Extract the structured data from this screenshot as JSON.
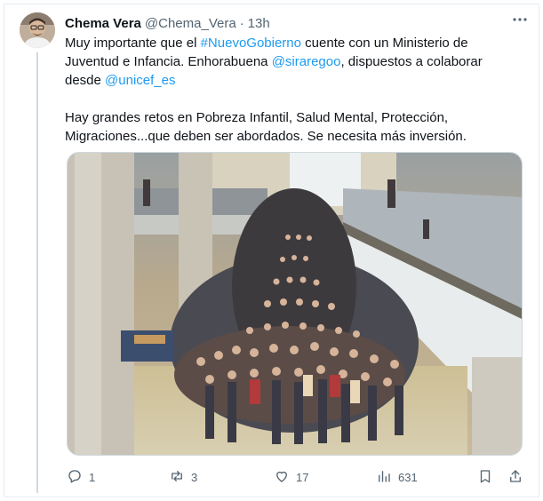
{
  "author": {
    "name": "Chema Vera",
    "handle": "@Chema_Vera",
    "separator": "·",
    "time": "13h"
  },
  "tweet": {
    "p1_a": "Muy importante que el ",
    "p1_hashtag": "#NuevoGobierno",
    "p1_b": " cuente con un Ministerio de Juventud e Infancia. Enhorabuena ",
    "p1_mention1": "@siraregoo",
    "p1_c": ", dispuestos a colaborar desde ",
    "p1_mention2": "@unicef_es",
    "p2": "Hay grandes retos en Pobreza Infantil, Salud Mental, Protección, Migraciones...que deben ser abordados. Se necesita más inversión."
  },
  "actions": {
    "replies": "1",
    "retweets": "3",
    "likes": "17",
    "views": "631"
  },
  "icons": {
    "more": "more-dots-icon",
    "reply": "reply-icon",
    "retweet": "retweet-icon",
    "like": "heart-icon",
    "views": "analytics-icon",
    "bookmark": "bookmark-icon",
    "share": "share-icon"
  },
  "colors": {
    "link": "#1d9bf0",
    "muted": "#536471",
    "text": "#0f1419"
  }
}
